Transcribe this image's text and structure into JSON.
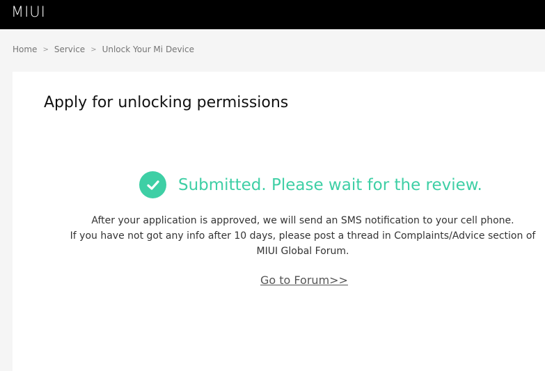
{
  "header": {
    "logo": "MIUI"
  },
  "breadcrumb": {
    "items": [
      "Home",
      "Service",
      "Unlock Your Mi Device"
    ],
    "separator": ">"
  },
  "card": {
    "title": "Apply for unlocking permissions",
    "status": {
      "icon": "check-circle-icon",
      "text": "Submitted. Please wait for the review.",
      "color": "#3ecfa5"
    },
    "info_line1": "After your application is approved, we will send an SMS notification to your cell phone.",
    "info_line2": "If you have not got any info after 10 days, please post a thread in Complaints/Advice section of MIUI Global Forum.",
    "forum_link": "Go to Forum>>"
  }
}
